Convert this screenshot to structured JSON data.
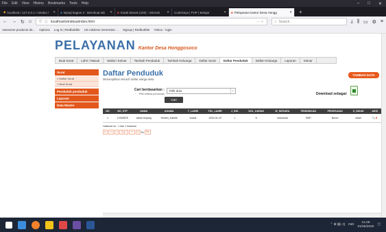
{
  "menubar": [
    "File",
    "Edit",
    "View",
    "History",
    "Bookmarks",
    "Tools",
    "Help"
  ],
  "tabs": [
    {
      "label": "localhost / 127.0.0.1 / simdes /",
      "active": false
    },
    {
      "label": "Mysql bagian 2 : Membuat tab",
      "active": false
    },
    {
      "label": "Kotak Masuk (226) - mikmak",
      "active": false
    },
    {
      "label": "CodeSaya | PHP | Belajar",
      "active": false
    },
    {
      "label": "Pelayanan Kantor Desa Hongg",
      "active": true
    }
  ],
  "nav": {
    "url": "localhost/simdesa/index.html",
    "search_placeholder": "Search"
  },
  "bookmarks": [
    "Awesome products de...",
    "Options",
    "Log In | Redbubble",
    "US Address Generator ...",
    "Signup | Redbubble",
    "Yahoo - login"
  ],
  "site": {
    "title": "PELAYANAN",
    "subtitle": "Kantor Desa Honggosoco",
    "nav": [
      "Buat Surat",
      "Lahir / Masuk",
      "Wafat / Keluar",
      "Tambah Penduduk",
      "Tambah Keluarga",
      "Daftar Surat",
      "Daftar Penduduk",
      "Daftar Keluarga",
      "Laporan",
      "Keluar"
    ],
    "active_nav": "Daftar Penduduk"
  },
  "leftmenu": [
    {
      "head": "Surat",
      "items": [
        "» Daftar Surat",
        "» Buat Surat"
      ]
    },
    {
      "head": "Penduduk penduduk",
      "items": []
    },
    {
      "head": "Laporan",
      "items": []
    },
    {
      "head": "Data Master",
      "items": []
    }
  ],
  "content": {
    "title": "Daftar Penduduk",
    "subtitle": "Menampilkan seluruh daftar warga desa",
    "tambah_label": "TAMBAH DATA",
    "search_label": "Cari berdasarkan :",
    "search_hint": "Pilih kriteria pencarian",
    "select_value": "Pilih dulu",
    "cari_label": "Cari",
    "download_label": "Download sebagai:"
  },
  "table": {
    "headers": [
      "NO",
      "NO_KTP",
      "NAMA",
      "AGAMA",
      "T_LAHIR",
      "TGL_LAHIR",
      "J_KEL",
      "GOL_DARAH",
      "W_NEGARA",
      "PENDIDIKAN",
      "PEKERJAAN",
      "S_NIKAH",
      "AKSI"
    ],
    "rows": [
      [
        "1",
        "12345678",
        "akbar tenjung",
        "Kristen_Katolik",
        "buduk",
        "1933-04-19",
        "L",
        "A",
        "indonesia",
        "SMP",
        "Buruh",
        "nikah",
        ""
      ]
    ]
  },
  "pager": {
    "info": "Halaman ke : 1 dari 1 halaman",
    "buttons": [
      "|<",
      "<<",
      "<",
      "1",
      ">",
      ">>",
      ">|"
    ],
    "go_label": "Ke",
    "go_value": "Ke"
  },
  "taskbar": {
    "lang": "IND",
    "time": "14.28",
    "date": "01/05/2020"
  }
}
